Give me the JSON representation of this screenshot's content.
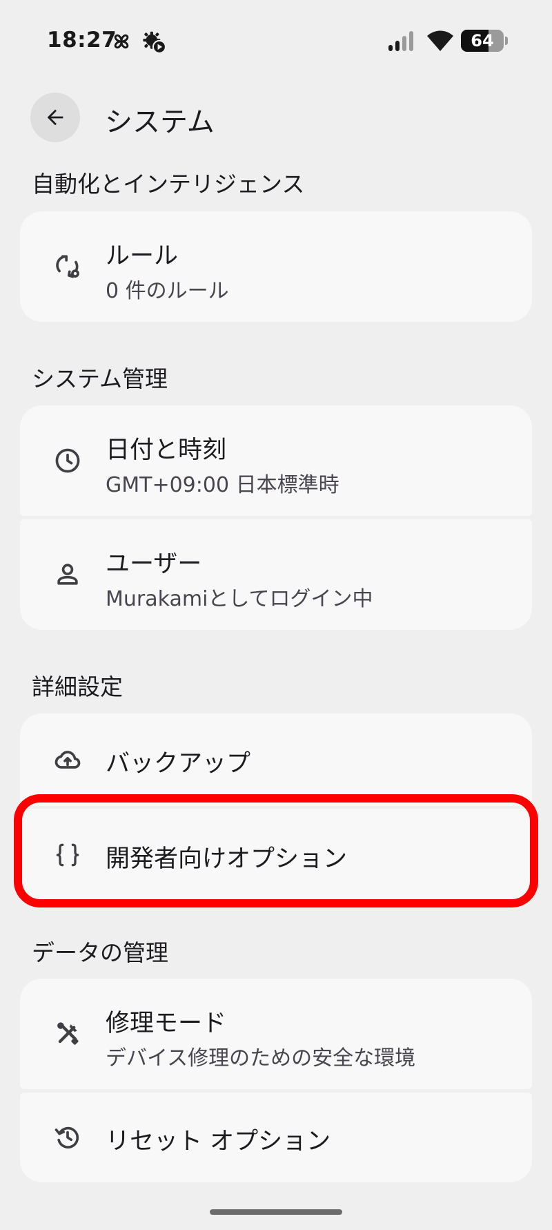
{
  "status_bar": {
    "time": "18:27",
    "battery_level": "64",
    "battery_fraction": 0.64,
    "icons": [
      "pinwheel-icon",
      "gear-play-icon",
      "signal-icon",
      "wifi-icon",
      "battery-icon"
    ]
  },
  "header": {
    "title": "システム",
    "back_icon": "arrow-left-icon"
  },
  "sections": {
    "automation": {
      "title": "自動化とインテリジェンス",
      "items": [
        {
          "title": "ルール",
          "subtitle": "0 件のルール",
          "icon": "rules-sync-icon"
        }
      ]
    },
    "system_management": {
      "title": "システム管理",
      "items": [
        {
          "title": "日付と時刻",
          "subtitle": "GMT+09:00 日本標準時",
          "icon": "clock-icon"
        },
        {
          "title": "ユーザー",
          "subtitle": "Murakamiとしてログイン中",
          "icon": "person-icon"
        }
      ]
    },
    "advanced": {
      "title": "詳細設定",
      "items": [
        {
          "title": "バックアップ",
          "icon": "cloud-upload-icon"
        },
        {
          "title": "開発者向けオプション",
          "icon": "braces-icon"
        }
      ]
    },
    "data_management": {
      "title": "データの管理",
      "items": [
        {
          "title": "修理モード",
          "subtitle": "デバイス修理のための安全な環境",
          "icon": "repair-tools-icon"
        },
        {
          "title": "リセット オプション",
          "icon": "history-icon"
        }
      ]
    }
  },
  "colors": {
    "background": "#efefef",
    "card": "#f8f8f8",
    "highlight": "#ff0000",
    "text_primary": "#1d1b20",
    "text_secondary": "#49454f"
  }
}
